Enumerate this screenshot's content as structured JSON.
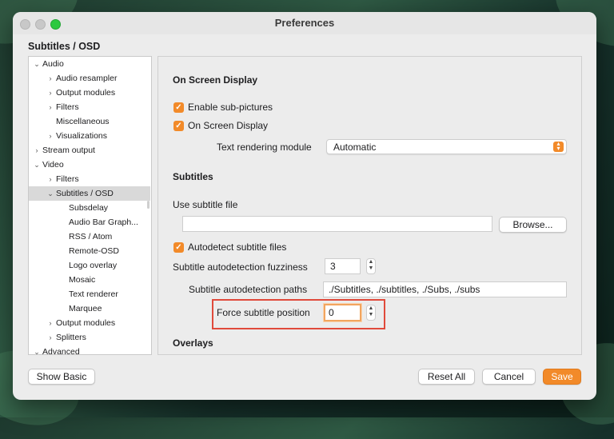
{
  "window": {
    "title": "Preferences"
  },
  "section_header": "Subtitles / OSD",
  "tree": [
    {
      "label": "Audio",
      "chevron": "⌄",
      "level": 0
    },
    {
      "label": "Audio resampler",
      "chevron": "›",
      "level": 1
    },
    {
      "label": "Output modules",
      "chevron": "›",
      "level": 1
    },
    {
      "label": "Filters",
      "chevron": "›",
      "level": 1
    },
    {
      "label": "Miscellaneous",
      "chevron": "",
      "level": 1
    },
    {
      "label": "Visualizations",
      "chevron": "›",
      "level": 1
    },
    {
      "label": "Stream output",
      "chevron": "›",
      "level": 0
    },
    {
      "label": "Video",
      "chevron": "⌄",
      "level": 0
    },
    {
      "label": "Filters",
      "chevron": "›",
      "level": 1
    },
    {
      "label": "Subtitles / OSD",
      "chevron": "⌄",
      "level": 1,
      "selected": true
    },
    {
      "label": "Subsdelay",
      "chevron": "",
      "level": 2
    },
    {
      "label": "Audio Bar Graph...",
      "chevron": "",
      "level": 2
    },
    {
      "label": "RSS / Atom",
      "chevron": "",
      "level": 2
    },
    {
      "label": "Remote-OSD",
      "chevron": "",
      "level": 2
    },
    {
      "label": "Logo overlay",
      "chevron": "",
      "level": 2
    },
    {
      "label": "Mosaic",
      "chevron": "",
      "level": 2
    },
    {
      "label": "Text renderer",
      "chevron": "",
      "level": 2
    },
    {
      "label": "Marquee",
      "chevron": "",
      "level": 2
    },
    {
      "label": "Output modules",
      "chevron": "›",
      "level": 1
    },
    {
      "label": "Splitters",
      "chevron": "›",
      "level": 1
    },
    {
      "label": "Advanced",
      "chevron": "⌄",
      "level": 0
    }
  ],
  "osd": {
    "heading": "On Screen Display",
    "enable_subpictures": "Enable sub-pictures",
    "on_screen_display": "On Screen Display",
    "text_rendering_label": "Text rendering module",
    "text_rendering_value": "Automatic"
  },
  "subtitles": {
    "heading": "Subtitles",
    "use_file_label": "Use subtitle file",
    "file_value": "",
    "browse": "Browse...",
    "autodetect": "Autodetect subtitle files",
    "fuzziness_label": "Subtitle autodetection fuzziness",
    "fuzziness_value": "3",
    "paths_label": "Subtitle autodetection paths",
    "paths_value": "./Subtitles, ./subtitles, ./Subs, ./subs",
    "force_position_label": "Force subtitle position",
    "force_position_value": "0"
  },
  "overlays": {
    "heading": "Overlays"
  },
  "footer": {
    "show_basic": "Show Basic",
    "reset_all": "Reset All",
    "cancel": "Cancel",
    "save": "Save"
  },
  "icons": {
    "checkmark": "✓",
    "stepper_up": "▲",
    "stepper_down": "▼",
    "popup": "⌃⌄"
  },
  "colors": {
    "accent": "#f28a29",
    "highlight": "#e04a3b"
  }
}
